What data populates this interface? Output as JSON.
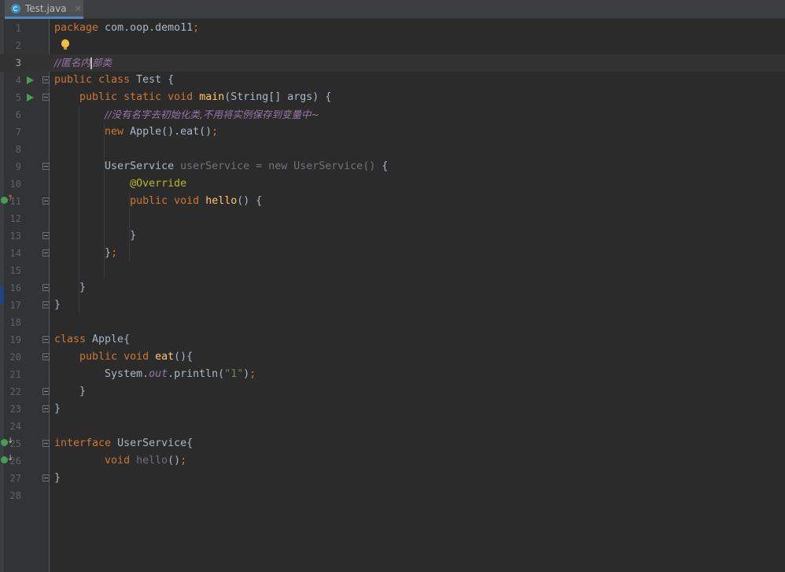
{
  "tab": {
    "label": "Test.java",
    "close": "×"
  },
  "lines": [
    {
      "n": "1",
      "code": "package com.oop.demo11;"
    },
    {
      "n": "2",
      "code": ""
    },
    {
      "n": "3",
      "code": "//匿名内部类"
    },
    {
      "n": "4",
      "code": "public class Test {"
    },
    {
      "n": "5",
      "code": "    public static void main(String[] args) {"
    },
    {
      "n": "6",
      "code": "        //没有名字去初始化类,不用将实例保存到变量中~"
    },
    {
      "n": "7",
      "code": "        new Apple().eat();"
    },
    {
      "n": "8",
      "code": ""
    },
    {
      "n": "9",
      "code": "        UserService userService = new UserService() {"
    },
    {
      "n": "10",
      "code": "            @Override"
    },
    {
      "n": "11",
      "code": "            public void hello() {"
    },
    {
      "n": "12",
      "code": ""
    },
    {
      "n": "13",
      "code": "            }"
    },
    {
      "n": "14",
      "code": "        };"
    },
    {
      "n": "15",
      "code": ""
    },
    {
      "n": "16",
      "code": "    }"
    },
    {
      "n": "17",
      "code": "}"
    },
    {
      "n": "18",
      "code": ""
    },
    {
      "n": "19",
      "code": "class Apple{"
    },
    {
      "n": "20",
      "code": "    public void eat(){"
    },
    {
      "n": "21",
      "code": "        System.out.println(\"1\");"
    },
    {
      "n": "22",
      "code": "    }"
    },
    {
      "n": "23",
      "code": "}"
    },
    {
      "n": "24",
      "code": ""
    },
    {
      "n": "25",
      "code": "interface UserService{"
    },
    {
      "n": "26",
      "code": "        void hello();"
    },
    {
      "n": "27",
      "code": "}"
    },
    {
      "n": "28",
      "code": ""
    }
  ],
  "tokens": {
    "l1": [
      "package",
      " com.oop.demo11",
      ";"
    ],
    "l3": "//匿名内",
    "l3b": "部类",
    "l4": [
      "public",
      "class",
      "Test",
      "{"
    ],
    "l5": [
      "public",
      "static",
      "void",
      "main",
      "(String[] args) {"
    ],
    "l6": "//没有名字去初始化类,不用将实例保存到变量中~",
    "l7": [
      "new",
      " Apple().eat()",
      ";"
    ],
    "l9": [
      "UserService ",
      "userService",
      " = ",
      "new",
      " UserService()",
      " {"
    ],
    "l10": "@Override",
    "l11": [
      "public",
      "void",
      "hello",
      "() {"
    ],
    "l13": "}",
    "l14": [
      "}",
      ";"
    ],
    "l16": "}",
    "l17": "}",
    "l19": [
      "class",
      " Apple{"
    ],
    "l20": [
      "public",
      "void",
      "eat",
      "(){"
    ],
    "l21": [
      "System.",
      "out",
      ".println(",
      "\"1\"",
      ")",
      ";"
    ],
    "l22": "}",
    "l23": "}",
    "l25": [
      "interface",
      " UserService{"
    ],
    "l26": [
      "void",
      "hello",
      "()",
      ";"
    ],
    "l27": "}"
  },
  "colors": {
    "background": "#2b2b2b",
    "gutter": "#313335",
    "keyword": "#cc7832",
    "method": "#ffc66d",
    "annotation": "#bbb529",
    "string": "#6a8759",
    "comment": "#9876aa",
    "run": "#499c54"
  },
  "icons": {
    "file": "java-class-icon",
    "run": "run-icon",
    "implemented": "implemented-method-icon",
    "implementing": "implementing-method-icon",
    "intention": "lightbulb-icon",
    "fold": "fold-icon"
  }
}
